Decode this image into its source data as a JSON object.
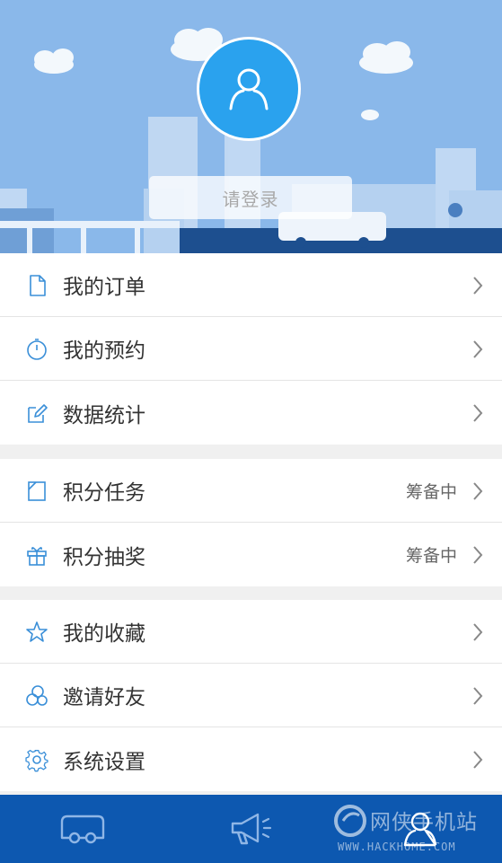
{
  "header": {
    "login_label": "请登录"
  },
  "menu_groups": [
    {
      "items": [
        {
          "label": "我的订单",
          "icon": "document-icon",
          "status": ""
        },
        {
          "label": "我的预约",
          "icon": "stopwatch-icon",
          "status": ""
        },
        {
          "label": "数据统计",
          "icon": "edit-icon",
          "status": ""
        }
      ]
    },
    {
      "items": [
        {
          "label": "积分任务",
          "icon": "task-icon",
          "status": "筹备中"
        },
        {
          "label": "积分抽奖",
          "icon": "gift-icon",
          "status": "筹备中"
        }
      ]
    },
    {
      "items": [
        {
          "label": "我的收藏",
          "icon": "star-icon",
          "status": ""
        },
        {
          "label": "邀请好友",
          "icon": "friends-icon",
          "status": ""
        },
        {
          "label": "系统设置",
          "icon": "gear-icon",
          "status": ""
        }
      ]
    }
  ],
  "tabbar": {
    "tabs": [
      {
        "icon": "car-icon"
      },
      {
        "icon": "megaphone-icon"
      },
      {
        "icon": "user-icon"
      }
    ]
  },
  "watermark": {
    "line1": "网侠手机站",
    "line2": "WWW.HACKHOME.COM"
  },
  "colors": {
    "accent": "#2aa2ee",
    "tabbar": "#0d58b0",
    "header_sky": "#8ab8ea",
    "icon_blue": "#3a8fd8"
  }
}
